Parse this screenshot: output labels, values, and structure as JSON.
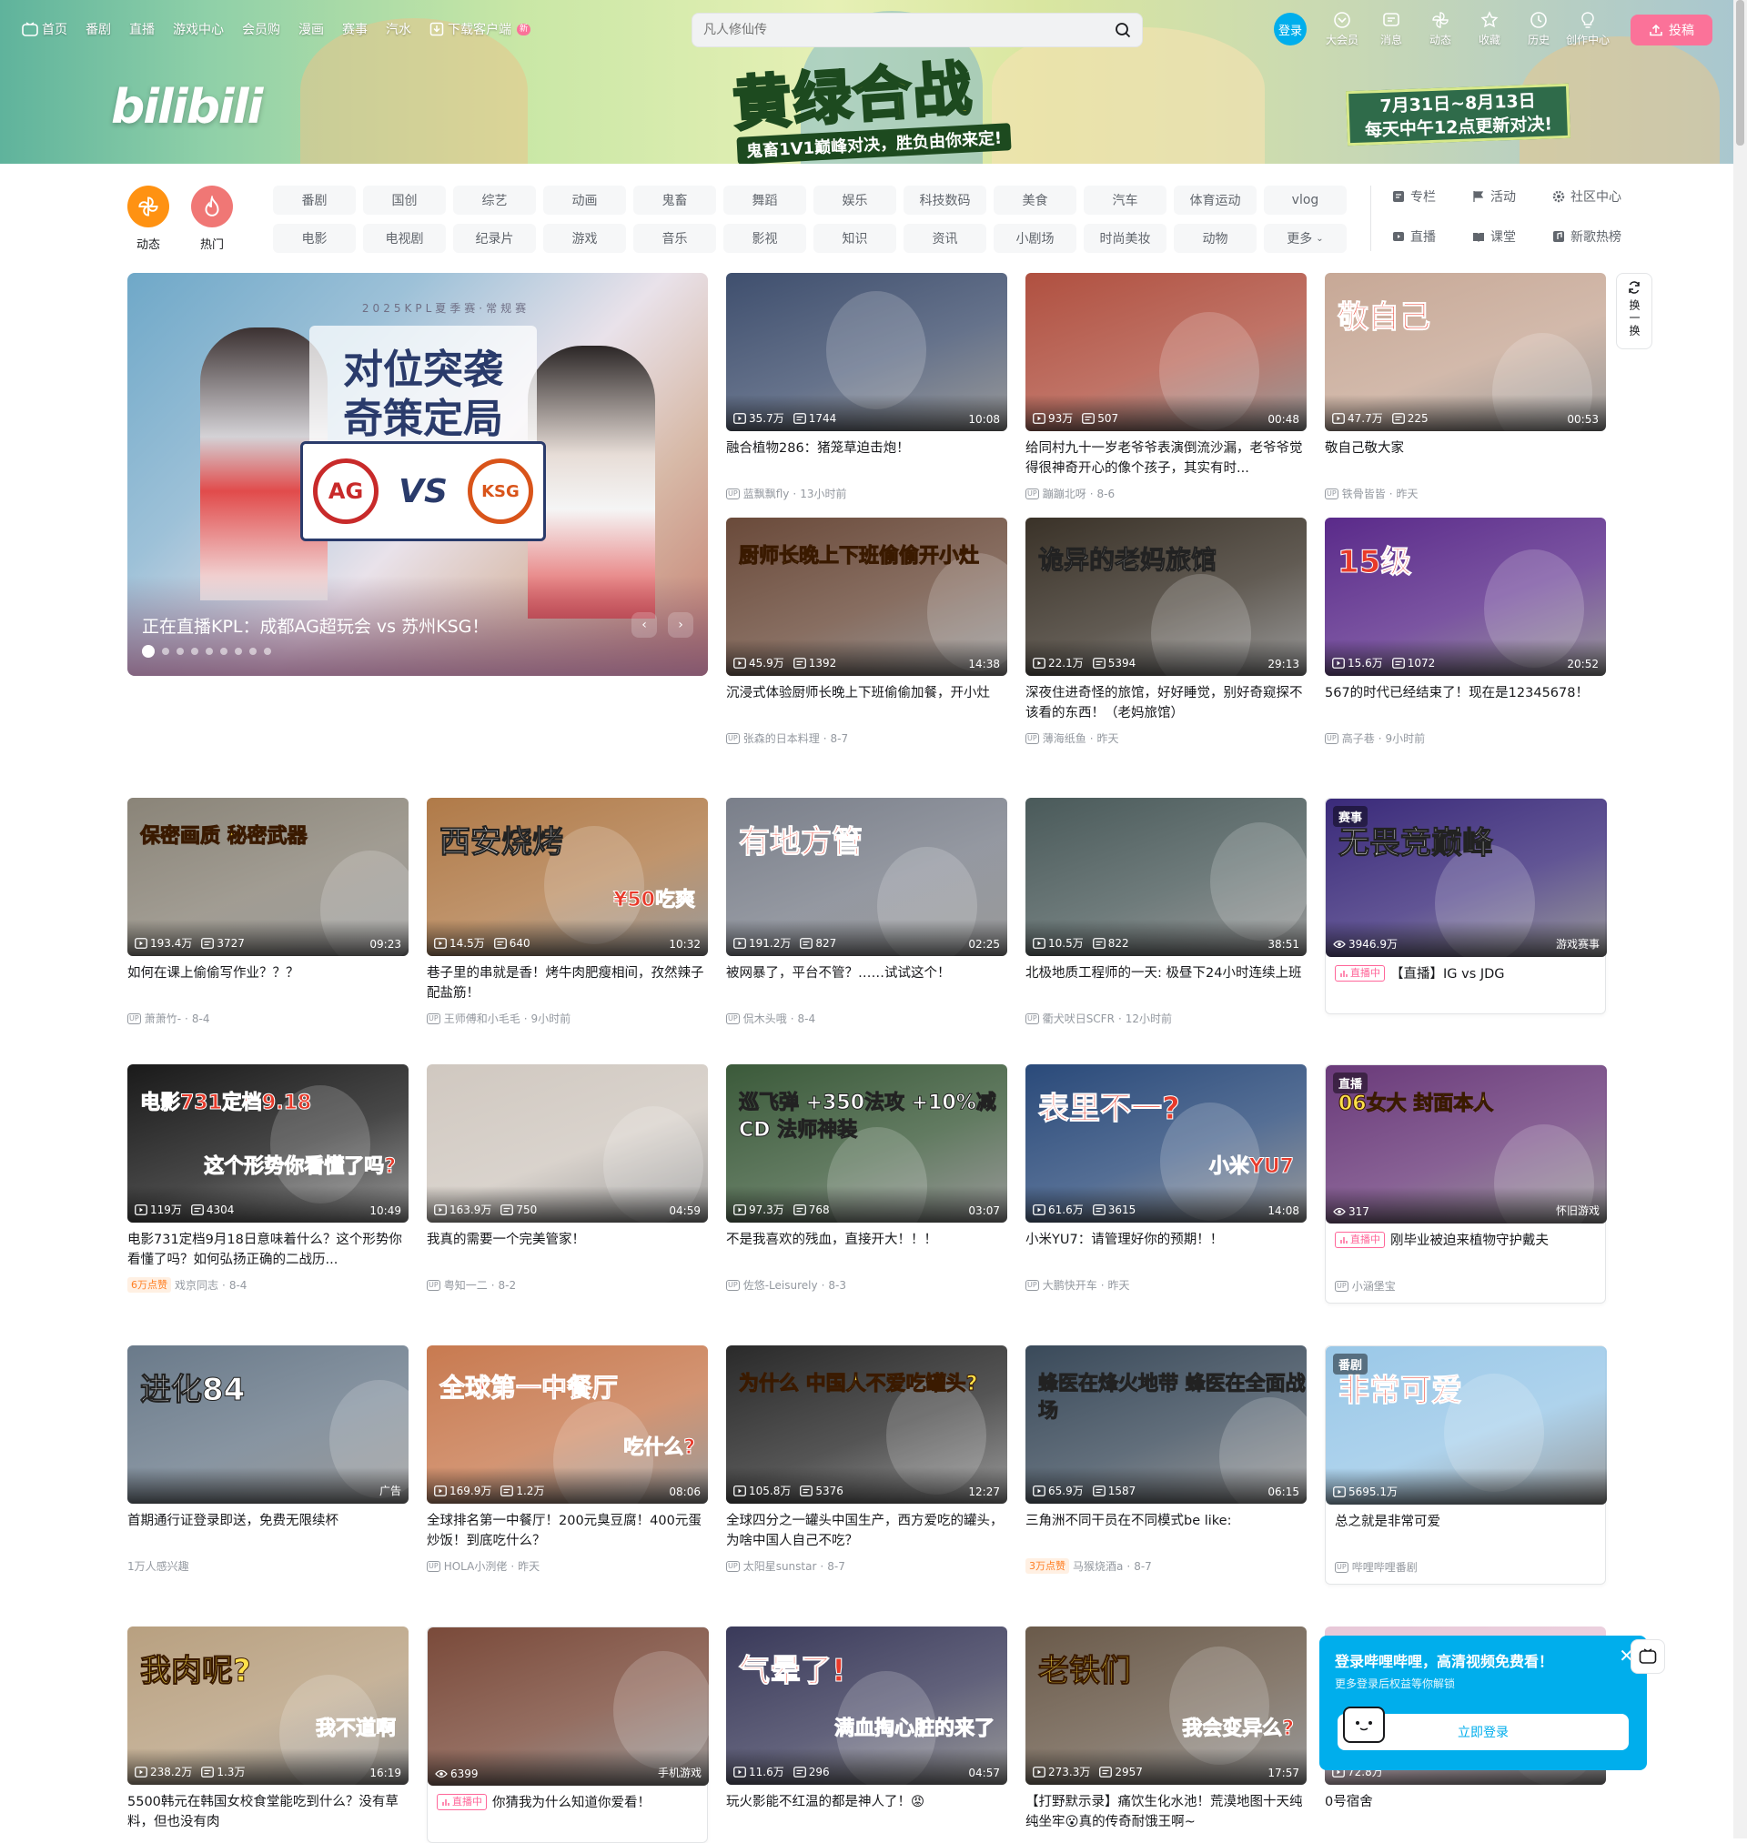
{
  "topnav": {
    "items": [
      "首页",
      "番剧",
      "直播",
      "游戏中心",
      "会员购",
      "漫画",
      "赛事",
      "汽水",
      "下载客户端"
    ],
    "new_badge": "新"
  },
  "search": {
    "placeholder": "凡人修仙传"
  },
  "user_nav": {
    "login": "登录",
    "items": [
      "大会员",
      "消息",
      "动态",
      "收藏",
      "历史",
      "创作中心"
    ],
    "upload": "投稿"
  },
  "banner": {
    "logo": "bilibili",
    "title": "黄绿合战",
    "subtitle": "鬼畜1V1巅峰对决，胜负由你来定!",
    "date_line1": "7月31日~8月13日",
    "date_line2": "每天中午12点更新对决!"
  },
  "channels": {
    "dynamic": "动态",
    "hot": "热门",
    "tags": [
      "番剧",
      "国创",
      "综艺",
      "动画",
      "鬼畜",
      "舞蹈",
      "娱乐",
      "科技数码",
      "美食",
      "汽车",
      "体育运动",
      "vlog",
      "电影",
      "电视剧",
      "纪录片",
      "游戏",
      "音乐",
      "影视",
      "知识",
      "资讯",
      "小剧场",
      "时尚美妆",
      "动物",
      "更多"
    ],
    "extras": [
      "专栏",
      "活动",
      "社区中心",
      "直播",
      "课堂",
      "新歌热榜"
    ]
  },
  "carousel": {
    "caption": "正在直播KPL：成都AG超玩会 vs 苏州KSG！",
    "image_title_1": "对位突袭",
    "image_title_2": "奇策定局",
    "image_header": "2025KPL夏季赛·常规赛",
    "team_a": "AG",
    "team_b": "KSG",
    "vs": "VS",
    "slide_count": 9,
    "active_slide": 0
  },
  "refresh": {
    "label": "换一换"
  },
  "videos": [
    {
      "title": "融合植物286：猪笼草迫击炮！",
      "views": "35.7万",
      "danmaku": "1744",
      "duration": "10:08",
      "up": "蓝飘飘fly",
      "date": "13小时前",
      "color": "#3f4f6e"
    },
    {
      "title": "给同村九十一岁老爷爷表演倒流沙漏，老爷爷觉得很神奇开心的像个孩子，其实有时...",
      "views": "93万",
      "danmaku": "507",
      "duration": "00:48",
      "up": "蹦蹦北呀",
      "date": "8-6",
      "color": "#b05040"
    },
    {
      "title": "敬自己敬大家",
      "views": "47.7万",
      "danmaku": "225",
      "duration": "00:53",
      "up": "铁骨皆皆",
      "date": "昨天",
      "color": "#c7a896",
      "thumb_text": "敬自己"
    },
    {
      "title": "沉浸式体验厨师长晚上下班偷偷加餐，开小灶",
      "views": "45.9万",
      "danmaku": "1392",
      "duration": "14:38",
      "up": "张森的日本料理",
      "date": "8-7",
      "color": "#6a4a3a",
      "thumb_text": "厨师长晚上下班偷偷开小灶"
    },
    {
      "title": "深夜住进奇怪的旅馆，好好睡觉，别好奇窥探不该看的东西！（老妈旅馆）",
      "views": "22.1万",
      "danmaku": "5394",
      "duration": "29:13",
      "up": "薄海纸鱼",
      "date": "昨天",
      "color": "#3a3228",
      "thumb_text": "诡异的老妈旅馆"
    },
    {
      "title": "567的时代已经结束了！现在是12345678！",
      "views": "15.6万",
      "danmaku": "1072",
      "duration": "20:52",
      "up": "高子巷",
      "date": "9小时前",
      "color": "#5a2a8a",
      "thumb_text": "15级"
    },
    {
      "title": "如何在课上偷偷写作业？？？",
      "views": "193.4万",
      "danmaku": "3727",
      "duration": "09:23",
      "up": "萧萧竹-",
      "date": "8-4",
      "color": "#8a8478",
      "thumb_text": "保密画质 秘密武器"
    },
    {
      "title": "巷子里的串就是香！烤牛肉肥瘦相间，孜然辣子配盐筋！",
      "views": "14.5万",
      "danmaku": "640",
      "duration": "10:32",
      "up": "王师傅和小毛毛",
      "date": "9小时前",
      "color": "#b07a48",
      "thumb_text": "西安烧烤",
      "thumb_text_2": "¥50吃爽"
    },
    {
      "title": "被网暴了，平台不管？……试试这个！",
      "views": "191.2万",
      "danmaku": "827",
      "duration": "02:25",
      "up": "侃木头哦",
      "date": "8-4",
      "color": "#7a7f8a",
      "thumb_text": "有地方管"
    },
    {
      "title": "北极地质工程师的一天: 极昼下24小时连续上班",
      "views": "10.5万",
      "danmaku": "822",
      "duration": "38:51",
      "up": "衢犬吠日SCFR",
      "date": "12小时前",
      "color": "#4a5a5a"
    },
    {
      "title": "【直播】IG vs JDG",
      "views": "3946.9万",
      "duration_label": "游戏赛事",
      "badge": "赛事",
      "live": "直播中",
      "color": "#3a2a7a",
      "thumb_text": "无畏竞巅峰"
    },
    {
      "title": "电影731定档9月18日意味着什么？这个形势你看懂了吗？如何弘扬正确的二战历...",
      "views": "119万",
      "danmaku": "4304",
      "duration": "10:49",
      "up": "戏京同志",
      "date": "8-4",
      "hot": "6万点赞",
      "color": "#1a1a1a",
      "thumb_text": "电影731定档9.18",
      "thumb_text_2": "这个形势你看懂了吗?"
    },
    {
      "title": "我真的需要一个完美管家！",
      "views": "163.9万",
      "danmaku": "750",
      "duration": "04:59",
      "up": "粤知一二",
      "date": "8-2",
      "color": "#d0c8c0"
    },
    {
      "title": "不是我喜欢的残血，直接开大！！！",
      "views": "97.3万",
      "danmaku": "768",
      "duration": "03:07",
      "up": "佐悠-Leisurely",
      "date": "8-3",
      "color": "#3b5a3a",
      "thumb_text": "巡飞弹 +350法攻 +10%减CD 法师神装"
    },
    {
      "title": "小米YU7：请管理好你的预期！！",
      "views": "61.6万",
      "danmaku": "3615",
      "duration": "14:08",
      "up": "大鹏快开车",
      "date": "昨天",
      "color": "#2a4a7a",
      "thumb_text": "表里不一?",
      "thumb_text_2": "小米YU7"
    },
    {
      "title": "刚毕业被迫来植物守护戴夫",
      "views": "317",
      "duration_label": "怀旧游戏",
      "badge": "直播",
      "live": "直播中",
      "up": "小涵堡宝",
      "color": "#6a3a7a",
      "thumb_text": "06女大 封面本人"
    },
    {
      "title": "首期通行证登录即送，免费无限续杯",
      "ad": "广告",
      "interest": "1万人感兴趣",
      "color": "#6a7a8a",
      "thumb_text": "进化84"
    },
    {
      "title": "全球排名第一中餐厅！200元臭豆腐！400元蛋炒饭！到底吃什么？",
      "views": "169.9万",
      "danmaku": "1.2万",
      "duration": "08:06",
      "up": "HOLA小洌佬",
      "date": "昨天",
      "color": "#c87a50",
      "thumb_text": "全球第一中餐厅",
      "thumb_text_2": "吃什么?"
    },
    {
      "title": "全球四分之一罐头中国生产，西方爱吃的罐头，为啥中国人自己不吃？",
      "views": "105.8万",
      "danmaku": "5376",
      "duration": "12:27",
      "up": "太阳星sunstar",
      "date": "8-7",
      "color": "#2a2a2a",
      "thumb_text": "为什么 中国人不爱吃罐头?"
    },
    {
      "title": "三角洲不同干员在不同模式be like:",
      "views": "65.9万",
      "danmaku": "1587",
      "duration": "06:15",
      "up": "马猴烧酒a",
      "date": "8-7",
      "hot": "3万点赞",
      "color": "#3a4a5a",
      "thumb_text": "蜂医在烽火地带 蜂医在全面战场"
    },
    {
      "title": "总之就是非常可爱",
      "views": "5695.1万",
      "badge": "番剧",
      "up": "哔哩哔哩番剧",
      "color": "#9ac8e8",
      "thumb_text": "非常可爱"
    },
    {
      "title": "5500韩元在韩国女校食堂能吃到什么？没有草料，但也没有肉",
      "views": "238.2万",
      "danmaku": "1.3万",
      "duration": "16:19",
      "color": "#b8a080",
      "thumb_text": "我肉呢?",
      "thumb_text_2": "我不道啊"
    },
    {
      "title": "你猜我为什么知道你爱看！",
      "views": "6399",
      "duration_label": "手机游戏",
      "live": "直播中",
      "color": "#7a4a3a"
    },
    {
      "title": "玩火影能不红温的都是神人了！😡",
      "views": "11.6万",
      "danmaku": "296",
      "duration": "04:57",
      "color": "#3a3a5a",
      "thumb_text": "气晕了!",
      "thumb_text_2": "满血掏心脏的来了"
    },
    {
      "title": "【打野默示录】痛饮生化水池！荒漠地图十天纯纯坐牢😮真的传奇耐饿王啊~",
      "views": "273.3万",
      "danmaku": "2957",
      "duration": "17:57",
      "color": "#6a5a4a",
      "thumb_text": "老铁们",
      "thumb_text_2": "我会变异么?"
    },
    {
      "title": "0号宿舍",
      "views": "72.8万",
      "color": "#e8c8d8"
    }
  ],
  "login_popup": {
    "title": "登录哔哩哔哩，高清视频免费看！",
    "subtitle": "更多登录后权益等你解锁",
    "button": "立即登录"
  }
}
